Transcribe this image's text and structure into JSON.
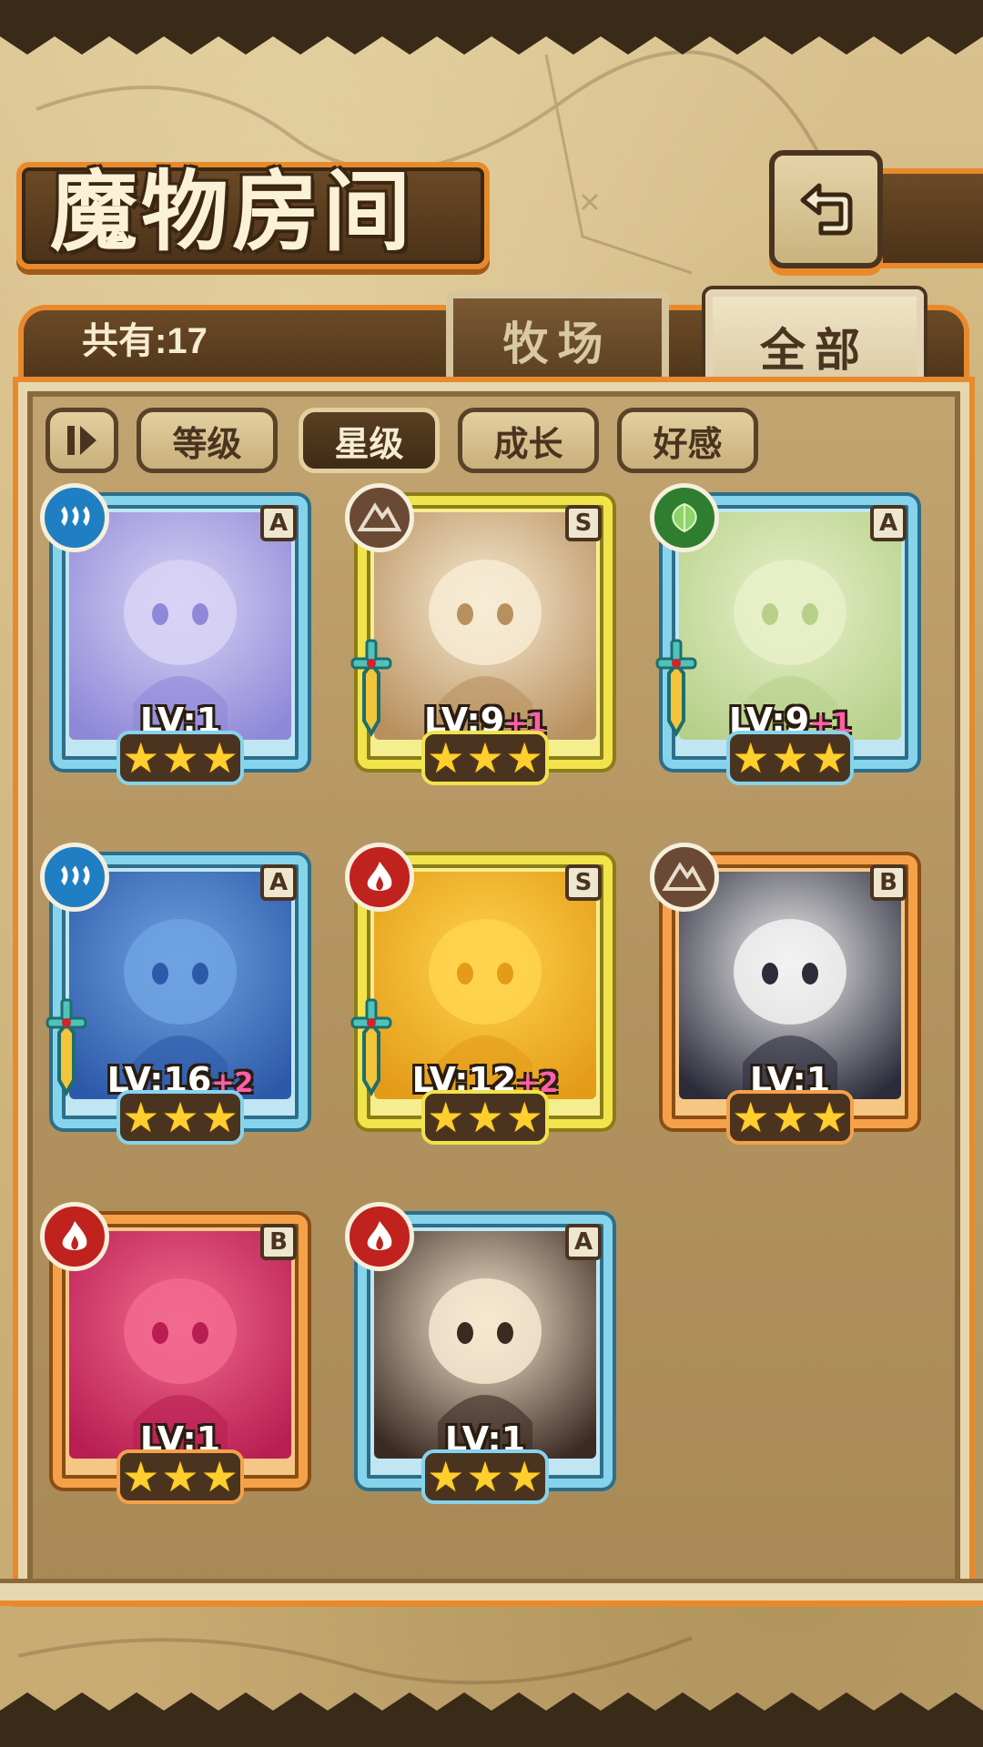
{
  "header": {
    "title": "魔物房间"
  },
  "panel": {
    "count_text": "共有:17",
    "tabs": [
      {
        "label": "牧场",
        "active": false
      },
      {
        "label": "全部",
        "active": true
      }
    ]
  },
  "filters": {
    "items": [
      {
        "label": "等级",
        "active": false
      },
      {
        "label": "星级",
        "active": true
      },
      {
        "label": "成长",
        "active": false
      },
      {
        "label": "好感",
        "active": false
      }
    ]
  },
  "colors": {
    "accent_orange": "#e88a2c",
    "rank_a": "#86d3ec",
    "rank_s": "#f0e34c",
    "rank_b": "#f4a14a",
    "bonus_pink": "#ff5fa8",
    "star_gold": "#ffcf2e"
  },
  "monsters": [
    {
      "rank": "A",
      "element": "water",
      "element_icon": "water-element-icon",
      "level": "LV:1",
      "bonus": "",
      "stars": 3,
      "has_weapon": false,
      "art": [
        "#d8d4f4",
        "#8f88d8"
      ]
    },
    {
      "rank": "S",
      "element": "earth",
      "element_icon": "earth-element-icon",
      "level": "LV:9",
      "bonus": "+1",
      "stars": 3,
      "has_weapon": true,
      "art": [
        "#f7ebd3",
        "#b8905e"
      ]
    },
    {
      "rank": "A",
      "element": "wood",
      "element_icon": "wood-element-icon",
      "level": "LV:9",
      "bonus": "+1",
      "stars": 3,
      "has_weapon": true,
      "art": [
        "#e8f0c8",
        "#b6d08a"
      ]
    },
    {
      "rank": "A",
      "element": "water",
      "element_icon": "water-element-icon",
      "level": "LV:16",
      "bonus": "+2",
      "stars": 3,
      "has_weapon": true,
      "art": [
        "#6fa2e2",
        "#2d5aa8"
      ]
    },
    {
      "rank": "S",
      "element": "fire",
      "element_icon": "fire-element-icon",
      "level": "LV:12",
      "bonus": "+2",
      "stars": 3,
      "has_weapon": true,
      "art": [
        "#ffd34d",
        "#e39b18"
      ]
    },
    {
      "rank": "B",
      "element": "earth",
      "element_icon": "earth-element-icon",
      "level": "LV:1",
      "bonus": "",
      "stars": 3,
      "has_weapon": false,
      "art": [
        "#f2f2f2",
        "#2b2b3a"
      ]
    },
    {
      "rank": "B",
      "element": "fire",
      "element_icon": "fire-element-icon",
      "level": "LV:1",
      "bonus": "",
      "stars": 3,
      "has_weapon": false,
      "art": [
        "#f26a8f",
        "#b81e52"
      ]
    },
    {
      "rank": "A",
      "element": "fire",
      "element_icon": "fire-element-icon",
      "level": "LV:1",
      "bonus": "",
      "stars": 3,
      "has_weapon": false,
      "art": [
        "#f8e8d0",
        "#3a2a22"
      ]
    }
  ]
}
